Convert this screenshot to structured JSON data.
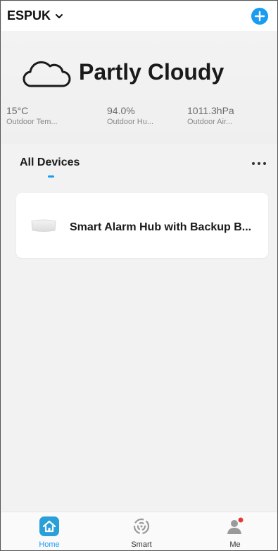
{
  "header": {
    "home_name": "ESPUK",
    "accent": "#1a9cf0"
  },
  "weather": {
    "condition": "Partly Cloudy",
    "icon": "cloud-icon",
    "stats": [
      {
        "value": "15°C",
        "label": "Outdoor Tem..."
      },
      {
        "value": "94.0%",
        "label": "Outdoor Hu..."
      },
      {
        "value": "1011.3hPa",
        "label": "Outdoor Air..."
      }
    ]
  },
  "devices_section": {
    "tab_label": "All Devices",
    "more_icon": "more-horizontal-icon",
    "devices": [
      {
        "name": "Smart Alarm Hub with Backup B...",
        "icon": "alarm-hub-device-icon"
      }
    ]
  },
  "bottom_nav": {
    "items": [
      {
        "label": "Home",
        "icon": "home-icon",
        "active": true
      },
      {
        "label": "Smart",
        "icon": "smart-icon",
        "active": false
      },
      {
        "label": "Me",
        "icon": "user-icon",
        "active": false,
        "badge_color": "#e53935"
      }
    ]
  }
}
